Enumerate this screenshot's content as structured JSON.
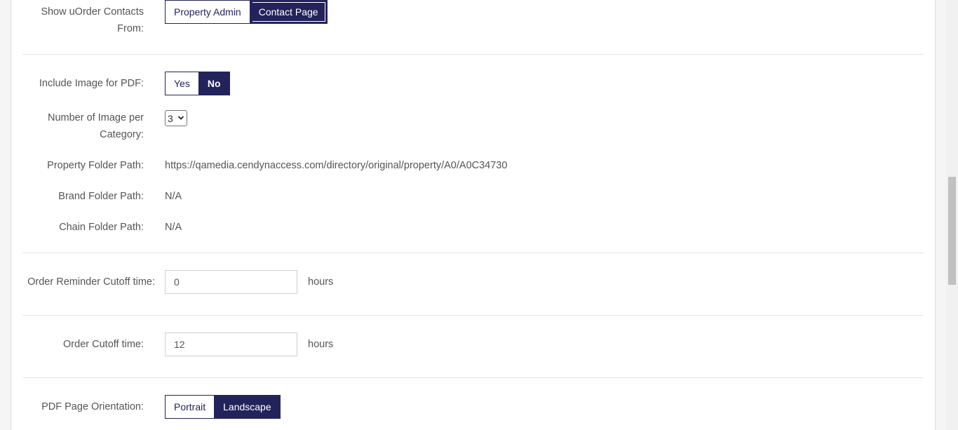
{
  "settings": {
    "show_contacts": {
      "label": "Show uOrder Contacts From:",
      "options": [
        "Property Admin",
        "Contact Page"
      ],
      "selected": "Contact Page"
    },
    "include_image": {
      "label": "Include Image for PDF:",
      "options": [
        "Yes",
        "No"
      ],
      "selected": "No"
    },
    "images_per_category": {
      "label": "Number of Image per Category:",
      "value": "3"
    },
    "property_folder": {
      "label": "Property Folder Path:",
      "value": "https://qamedia.cendynaccess.com/directory/original/property/A0/A0C34730"
    },
    "brand_folder": {
      "label": "Brand Folder Path:",
      "value": "N/A"
    },
    "chain_folder": {
      "label": "Chain Folder Path:",
      "value": "N/A"
    },
    "order_reminder_cutoff": {
      "label": "Order Reminder Cutoff time:",
      "value": "0",
      "unit": "hours"
    },
    "order_cutoff": {
      "label": "Order Cutoff time:",
      "value": "12",
      "unit": "hours"
    },
    "pdf_orientation": {
      "label": "PDF Page Orientation:",
      "options": [
        "Portrait",
        "Landscape"
      ],
      "selected": "Landscape"
    }
  },
  "colors": {
    "accent": "#23235b",
    "divider": "#e6e6e6",
    "text": "#555555"
  }
}
